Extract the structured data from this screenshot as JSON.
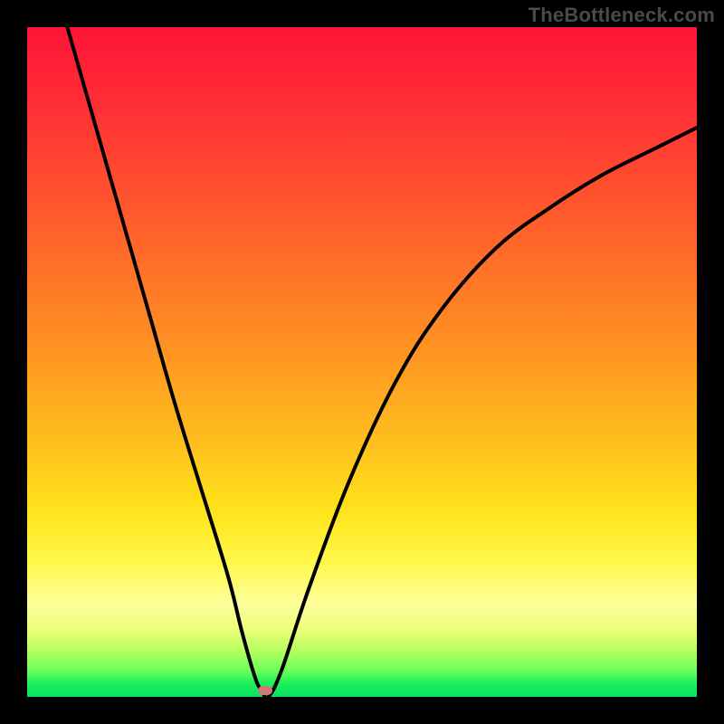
{
  "watermark": "TheBottleneck.com",
  "chart_data": {
    "type": "line",
    "title": "",
    "xlabel": "",
    "ylabel": "",
    "xlim": [
      0,
      100
    ],
    "ylim": [
      0,
      100
    ],
    "grid": false,
    "background": "red-to-green vertical gradient (bottleneck heatmap)",
    "series": [
      {
        "name": "bottleneck-curve",
        "x": [
          6,
          10,
          14,
          18,
          22,
          26,
          30,
          32,
          34,
          35,
          36,
          38,
          42,
          48,
          55,
          62,
          70,
          78,
          86,
          94,
          100
        ],
        "values": [
          100,
          86,
          72,
          58,
          44,
          31,
          18,
          10,
          3,
          1,
          0,
          4,
          16,
          32,
          47,
          58,
          67,
          73,
          78,
          82,
          85
        ]
      }
    ],
    "annotations": [
      {
        "name": "optimal-marker",
        "x": 35.5,
        "y": 1,
        "color": "#cf7a78"
      }
    ]
  },
  "colors": {
    "curve": "#000000",
    "frame": "#000000",
    "marker": "#cf7a78"
  }
}
